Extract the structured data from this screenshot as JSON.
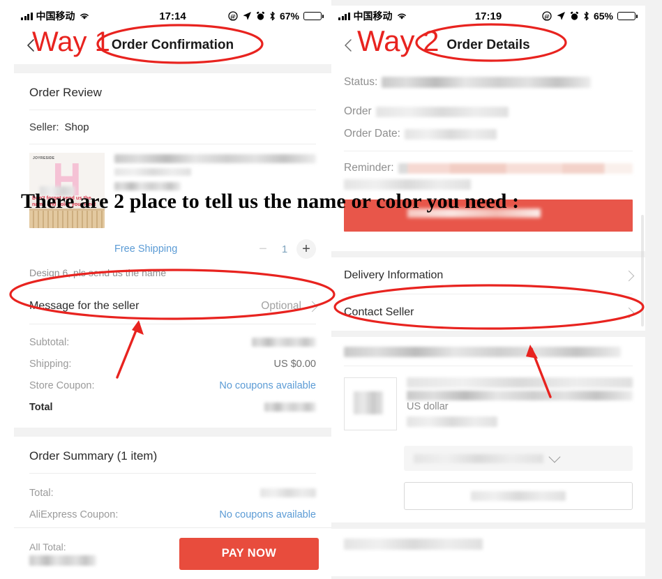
{
  "annotation": {
    "way1_label": "Way 1",
    "way2_label": "Way 2",
    "headline": "There are 2 place to tell us the name or color you need :",
    "highlight_color": "#e8231f"
  },
  "left": {
    "status_bar": {
      "carrier": "中国移动",
      "time": "17:14",
      "battery_pct": "67%",
      "icons": [
        "signal-bars-icon",
        "wifi-icon",
        "do-not-disturb-icon",
        "location-arrow-icon",
        "alarm-clock-icon",
        "bluetooth-icon",
        "battery-icon"
      ]
    },
    "nav": {
      "title": "Order Confirmation",
      "back_icon": "chevron-left-icon"
    },
    "order_review": {
      "section_title": "Order Review",
      "seller_label": "Seller:",
      "seller_name": "Shop",
      "product": {
        "image_brand": "JOYRESIDE",
        "image_caption": "Don't forget send us the name and color you need!",
        "free_shipping": "Free Shipping",
        "quantity": "1",
        "minus_label": "−",
        "plus_label": "+",
        "design_note": "Design 6, pls send us the name"
      }
    },
    "message_row": {
      "label": "Message for the seller",
      "value": "Optional",
      "chevron_icon": "chevron-right-icon"
    },
    "totals": [
      {
        "label": "Subtotal:",
        "value": "",
        "blurred": true,
        "link": false,
        "bold": false
      },
      {
        "label": "Shipping:",
        "value": "US $0.00",
        "blurred": false,
        "link": false,
        "bold": false
      },
      {
        "label": "Store Coupon:",
        "value": "No coupons available",
        "blurred": false,
        "link": true,
        "bold": false
      },
      {
        "label": "Total",
        "value": "",
        "blurred": true,
        "link": false,
        "bold": true
      }
    ],
    "order_summary": {
      "section_title": "Order Summary (1 item)",
      "rows": [
        {
          "label": "Total:",
          "value": "",
          "blurred": true,
          "link": false,
          "bold": false
        },
        {
          "label": "AliExpress Coupon:",
          "value": "No coupons available",
          "blurred": false,
          "link": true,
          "bold": false
        },
        {
          "label": "All Total:",
          "value": "",
          "blurred": true,
          "link": false,
          "bold": true
        }
      ]
    },
    "pay_bar": {
      "total_label": "All Total:",
      "pay_button": "PAY NOW",
      "pay_button_color": "#e84c3d"
    }
  },
  "right": {
    "status_bar": {
      "carrier": "中国移动",
      "time": "17:19",
      "battery_pct": "65%",
      "icons": [
        "signal-bars-icon",
        "wifi-icon",
        "do-not-disturb-icon",
        "location-arrow-icon",
        "alarm-clock-icon",
        "bluetooth-icon",
        "battery-icon"
      ]
    },
    "nav": {
      "title": "Order Details",
      "back_icon": "chevron-left-icon"
    },
    "order_info": [
      {
        "label": "Status:",
        "blurred": true
      },
      {
        "label": "Order",
        "blurred": true
      },
      {
        "label": "Order Date:",
        "blurred": true
      }
    ],
    "reminder": {
      "label": "Reminder:",
      "blurred": true
    },
    "links": [
      {
        "label": "Delivery Information",
        "chevron_icon": "chevron-right-icon"
      },
      {
        "label": "Contact Seller",
        "chevron_icon": "chevron-right-icon"
      }
    ],
    "product": {
      "currency_note": "US dollar"
    },
    "dropdown": {
      "chevron_icon": "chevron-down-icon"
    }
  }
}
